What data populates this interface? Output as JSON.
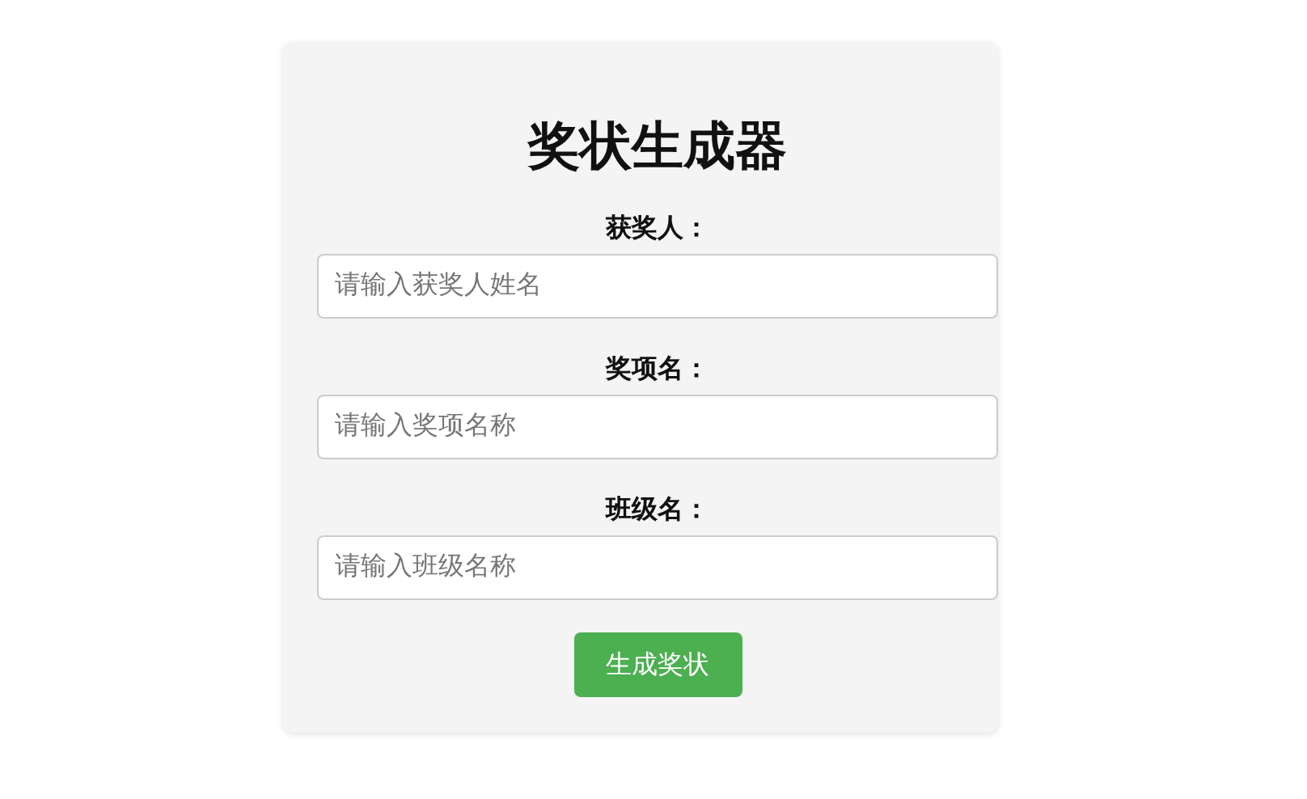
{
  "title": "奖状生成器",
  "fields": [
    {
      "label": "获奖人：",
      "placeholder": "请输入获奖人姓名"
    },
    {
      "label": "奖项名：",
      "placeholder": "请输入奖项名称"
    },
    {
      "label": "班级名：",
      "placeholder": "请输入班级名称"
    }
  ],
  "button": "生成奖状"
}
